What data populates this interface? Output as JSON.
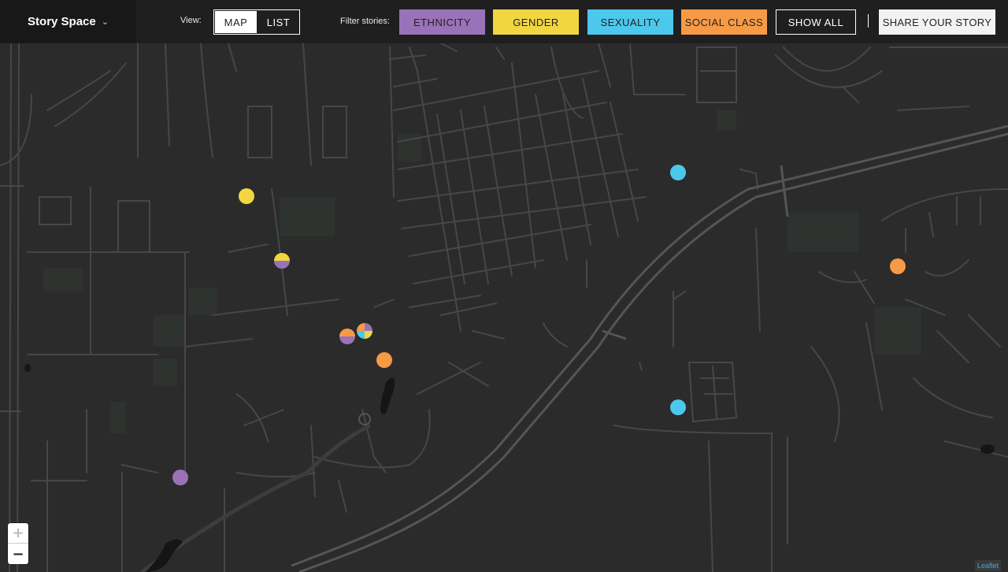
{
  "header": {
    "brand": "Story Space",
    "view_label": "View:",
    "view_options": [
      "MAP",
      "LIST"
    ],
    "view_selected": "MAP",
    "filter_label": "Filter stories:",
    "filters": [
      {
        "label": "ETHNICITY",
        "color": "#9a72b8"
      },
      {
        "label": "GENDER",
        "color": "#f2d641"
      },
      {
        "label": "SEXUALITY",
        "color": "#4cc8ec"
      },
      {
        "label": "SOCIAL CLASS",
        "color": "#f79a46"
      }
    ],
    "show_all": "SHOW ALL",
    "share": "SHARE YOUR STORY"
  },
  "map": {
    "zoom_in": "+",
    "zoom_out": "−",
    "attribution": "Leaflet",
    "colors": {
      "ethnicity": "#9a72b8",
      "gender": "#f2d641",
      "sexuality": "#4cc8ec",
      "social_class": "#f79a46",
      "background": "#2b2b2b",
      "roads": "#4a4a4a",
      "water": "#141414"
    }
  }
}
